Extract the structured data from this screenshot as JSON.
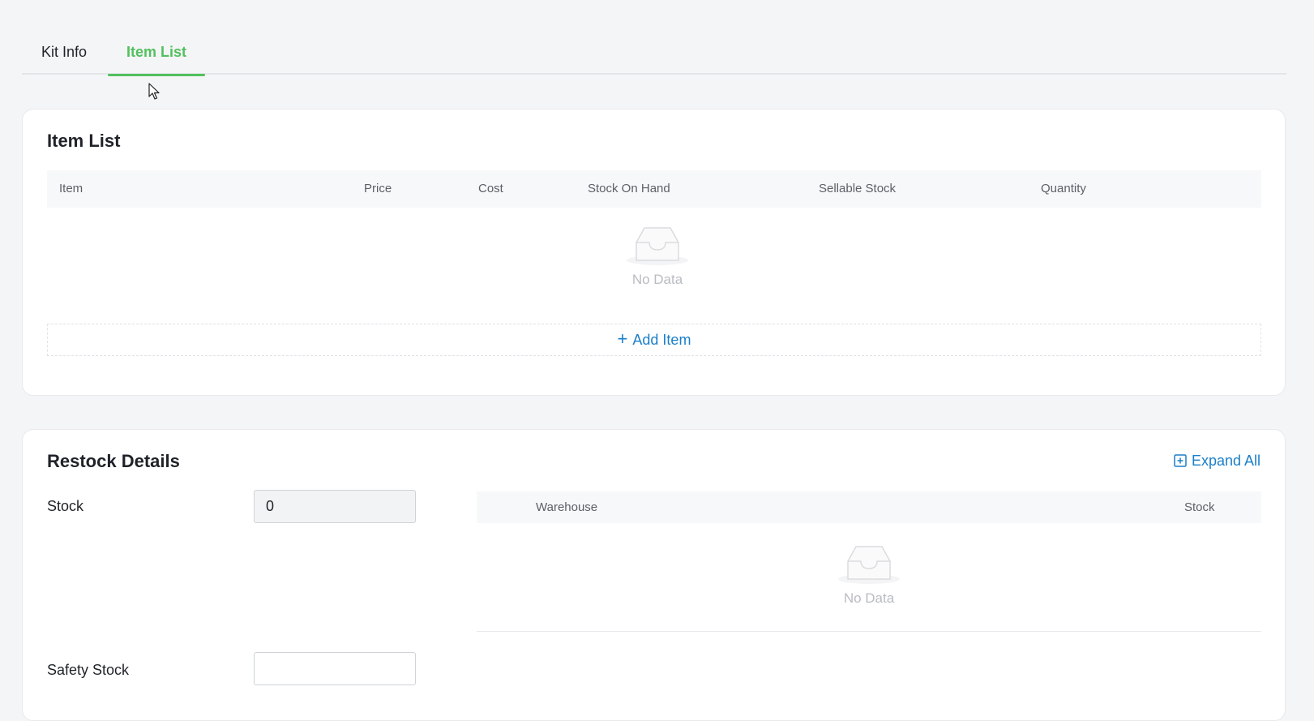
{
  "tabs": [
    {
      "label": "Kit Info"
    },
    {
      "label": "Item List"
    }
  ],
  "item_list": {
    "title": "Item List",
    "columns": [
      "Item",
      "Price",
      "Cost",
      "Stock On Hand",
      "Sellable Stock",
      "Quantity"
    ],
    "empty_text": "No Data",
    "add_label": "Add Item"
  },
  "restock": {
    "title": "Restock Details",
    "expand_label": "Expand All",
    "stock_label": "Stock",
    "stock_value": "0",
    "safety_stock_label": "Safety Stock",
    "safety_stock_value": "",
    "warehouse_columns": [
      "Warehouse",
      "Stock"
    ],
    "empty_text": "No Data"
  },
  "colors": {
    "accent_green": "#52c05e",
    "link_blue": "#1a7fc8",
    "background": "#f4f5f7"
  }
}
